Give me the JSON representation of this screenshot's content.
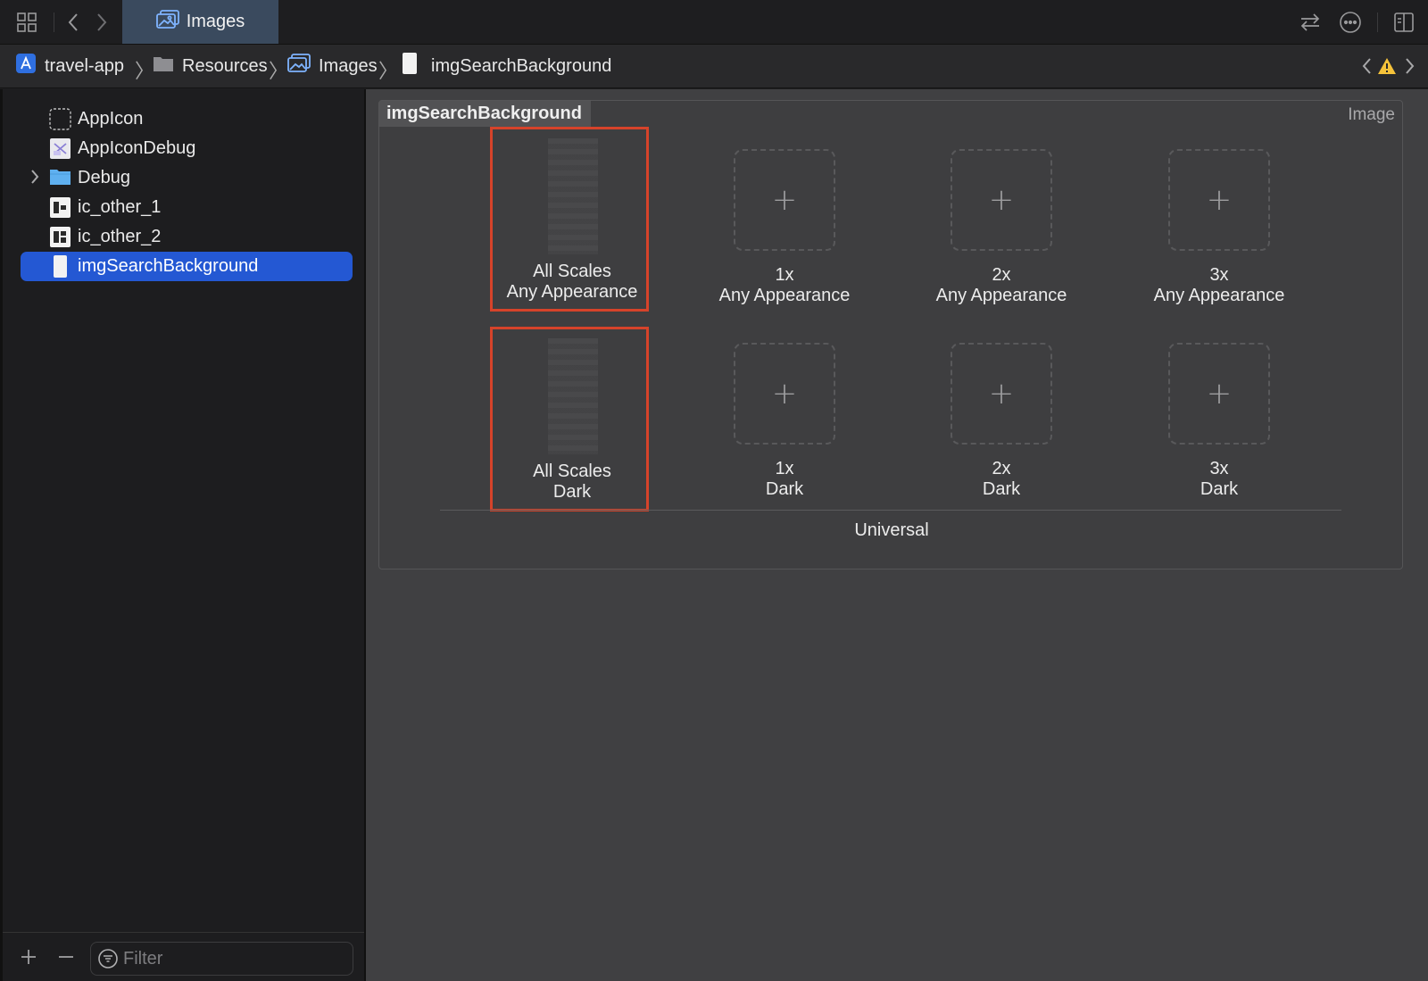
{
  "toolbar": {
    "active_tab": "Images"
  },
  "breadcrumb": {
    "project": "travel-app",
    "group": "Resources",
    "catalog": "Images",
    "asset": "imgSearchBackground"
  },
  "sidebar": {
    "items": [
      {
        "label": "AppIcon",
        "icon": "appicon-placeholder-icon"
      },
      {
        "label": "AppIconDebug",
        "icon": "appicon-debug-icon"
      },
      {
        "label": "Debug",
        "icon": "folder-icon"
      },
      {
        "label": "ic_other_1",
        "icon": "image-asset-icon"
      },
      {
        "label": "ic_other_2",
        "icon": "image-asset-icon"
      },
      {
        "label": "imgSearchBackground",
        "icon": "image-asset-icon"
      }
    ],
    "filter_placeholder": "Filter"
  },
  "asset": {
    "name": "imgSearchBackground",
    "type": "Image",
    "group_label": "Universal",
    "rows": [
      [
        {
          "scale": "All Scales",
          "appearance": "Any Appearance"
        },
        {
          "scale": "1x",
          "appearance": "Any Appearance"
        },
        {
          "scale": "2x",
          "appearance": "Any Appearance"
        },
        {
          "scale": "3x",
          "appearance": "Any Appearance"
        }
      ],
      [
        {
          "scale": "All Scales",
          "appearance": "Dark"
        },
        {
          "scale": "1x",
          "appearance": "Dark"
        },
        {
          "scale": "2x",
          "appearance": "Dark"
        },
        {
          "scale": "3x",
          "appearance": "Dark"
        }
      ]
    ]
  },
  "colors": {
    "selection": "#2458d3",
    "highlight": "#d6432a",
    "warning": "#f5c23a"
  }
}
